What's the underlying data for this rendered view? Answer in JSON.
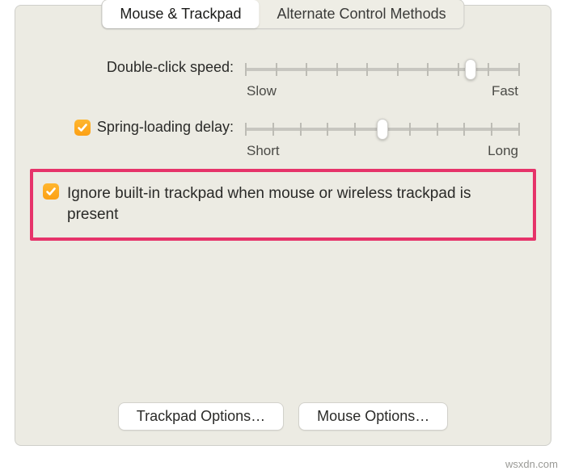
{
  "tabs": {
    "active": "Mouse & Trackpad",
    "inactive": "Alternate Control Methods"
  },
  "double_click": {
    "label": "Double-click speed:",
    "min_label": "Slow",
    "max_label": "Fast",
    "ticks": 10,
    "value_percent": 82
  },
  "spring_loading": {
    "checked": true,
    "label": "Spring-loading delay:",
    "min_label": "Short",
    "max_label": "Long",
    "ticks": 11,
    "value_percent": 50
  },
  "ignore_trackpad": {
    "checked": true,
    "label": "Ignore built-in trackpad when mouse or wireless trackpad is present"
  },
  "buttons": {
    "trackpad": "Trackpad Options…",
    "mouse": "Mouse Options…"
  },
  "watermark": "wsxdn.com"
}
